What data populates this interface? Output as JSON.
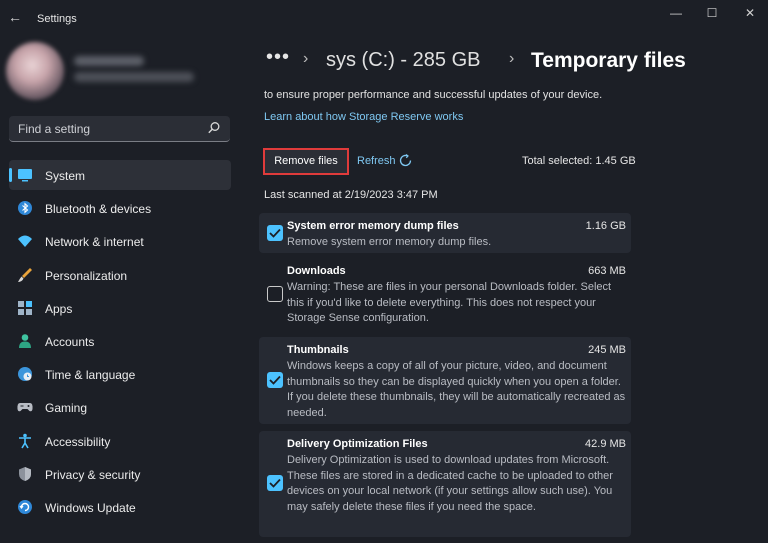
{
  "window": {
    "title": "Settings",
    "back": "←",
    "minimize": "—",
    "maximize": "☐",
    "close": "✕"
  },
  "search": {
    "placeholder": "Find a setting"
  },
  "sidebar": {
    "items": [
      {
        "label": "System",
        "icon": "monitor-icon",
        "active": true
      },
      {
        "label": "Bluetooth & devices",
        "icon": "bluetooth-icon"
      },
      {
        "label": "Network & internet",
        "icon": "wifi-icon"
      },
      {
        "label": "Personalization",
        "icon": "brush-icon"
      },
      {
        "label": "Apps",
        "icon": "apps-icon"
      },
      {
        "label": "Accounts",
        "icon": "person-icon"
      },
      {
        "label": "Time & language",
        "icon": "globe-clock-icon"
      },
      {
        "label": "Gaming",
        "icon": "gamepad-icon"
      },
      {
        "label": "Accessibility",
        "icon": "accessibility-icon"
      },
      {
        "label": "Privacy & security",
        "icon": "shield-icon"
      },
      {
        "label": "Windows Update",
        "icon": "update-icon"
      }
    ]
  },
  "breadcrumb": {
    "ellipsis": "•••",
    "separator": "›",
    "parent": "sys (C:) - 285 GB",
    "current": "Temporary files"
  },
  "main": {
    "intro_text": "to ensure proper performance and successful updates of your device.",
    "learn_link": "Learn about how Storage Reserve works",
    "remove_button": "Remove files",
    "refresh_label": "Refresh",
    "total_selected": "Total selected: 1.45 GB",
    "last_scanned": "Last scanned at 2/19/2023 3:47 PM"
  },
  "files": [
    {
      "title": "System error memory dump files",
      "size": "1.16 GB",
      "checked": true,
      "description": "Remove system error memory dump files."
    },
    {
      "title": "Downloads",
      "size": "663 MB",
      "checked": false,
      "description": "Warning: These are files in your personal Downloads folder. Select this if you'd like to delete everything. This does not respect your Storage Sense configuration."
    },
    {
      "title": "Thumbnails",
      "size": "245 MB",
      "checked": true,
      "description": "Windows keeps a copy of all of your picture, video, and document thumbnails so they can be displayed quickly when you open a folder. If you delete these thumbnails, they will be automatically recreated as needed."
    },
    {
      "title": "Delivery Optimization Files",
      "size": "42.9 MB",
      "checked": true,
      "description": "Delivery Optimization is used to download updates from Microsoft. These files are stored in a dedicated cache to be uploaded to other devices on your local network (if your settings allow such use). You may safely delete these files if you need the space."
    }
  ],
  "colors": {
    "accent": "#4cc2ff",
    "highlight_border": "#e03b3b",
    "background": "#1c1f26",
    "card": "#262a33"
  }
}
